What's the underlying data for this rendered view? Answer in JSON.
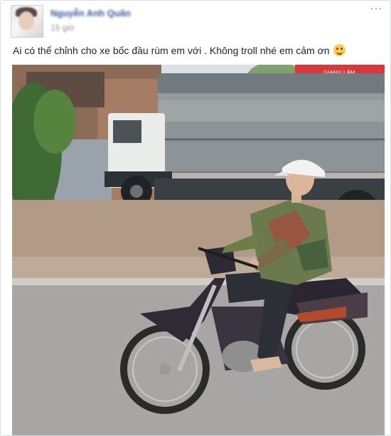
{
  "post": {
    "author": "Nguyễn Anh Quân",
    "time": "15 giờ",
    "more": "···",
    "caption": "Ai có thể chỉnh cho xe bốc đầu rùm em với . Không troll nhé em cảm ơn",
    "emoji_icon": "smiling-face-icon",
    "banner_text": "GIANG LÂM"
  },
  "colors": {
    "author": "#365899",
    "time": "#90949c",
    "text": "#1d2129",
    "border": "#dddfe2"
  }
}
